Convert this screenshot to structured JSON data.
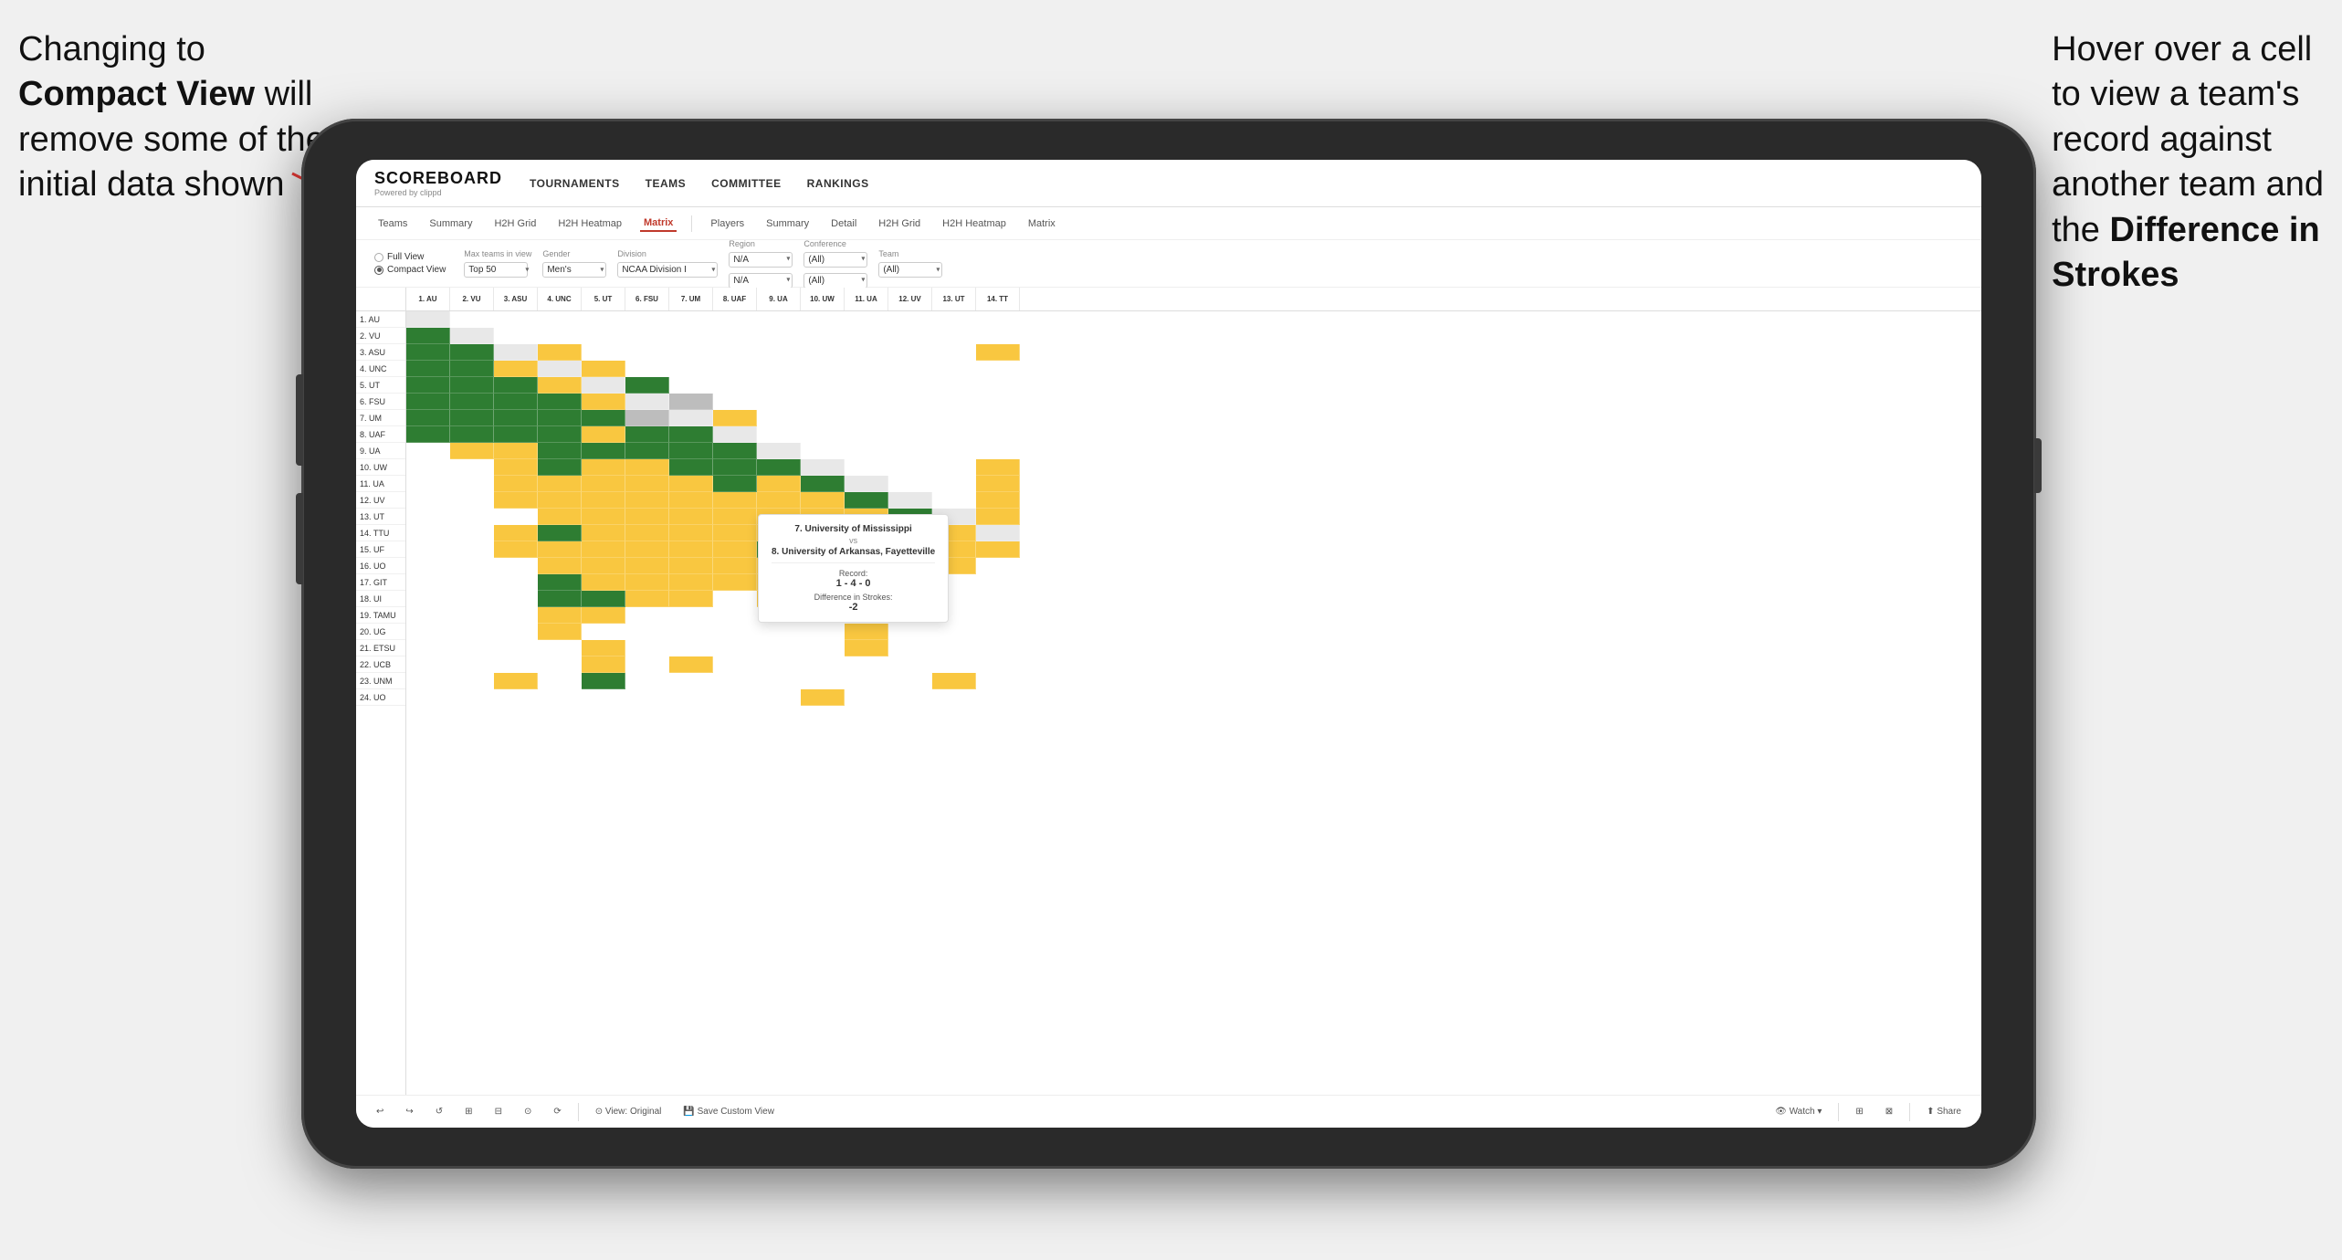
{
  "annotations": {
    "left": {
      "line1": "Changing to",
      "line2_bold": "Compact View",
      "line2_rest": " will",
      "line3": "remove some of the",
      "line4": "initial data shown"
    },
    "right": {
      "line1": "Hover over a cell",
      "line2": "to view a team's",
      "line3": "record against",
      "line4": "another team and",
      "line5_pre": "the ",
      "line5_bold": "Difference in",
      "line6_bold": "Strokes"
    }
  },
  "app": {
    "logo_title": "SCOREBOARD",
    "logo_subtitle": "Powered by clippd",
    "nav": [
      "TOURNAMENTS",
      "TEAMS",
      "COMMITTEE",
      "RANKINGS"
    ]
  },
  "sub_nav": {
    "group1": [
      "Teams",
      "Summary",
      "H2H Grid",
      "H2H Heatmap",
      "Matrix"
    ],
    "group2": [
      "Players",
      "Summary",
      "Detail",
      "H2H Grid",
      "H2H Heatmap",
      "Matrix"
    ],
    "active": "Matrix"
  },
  "filters": {
    "view_options": [
      "Full View",
      "Compact View"
    ],
    "selected_view": "Compact View",
    "max_teams_label": "Max teams in view",
    "max_teams_value": "Top 50",
    "gender_label": "Gender",
    "gender_value": "Men's",
    "division_label": "Division",
    "division_value": "NCAA Division I",
    "region_label": "Region",
    "region_value": "N/A",
    "conference_label": "Conference",
    "conference_value": "(All)",
    "team_label": "Team",
    "team_value": "(All)"
  },
  "col_headers": [
    "1. AU",
    "2. VU",
    "3. ASU",
    "4. UNC",
    "5. UT",
    "6. FSU",
    "7. UM",
    "8. UAF",
    "9. UA",
    "10. UW",
    "11. UA",
    "12. UV",
    "13. UT",
    "14. TT"
  ],
  "row_teams": [
    "1. AU",
    "2. VU",
    "3. ASU",
    "4. UNC",
    "5. UT",
    "6. FSU",
    "7. UM",
    "8. UAF",
    "9. UA",
    "10. UW",
    "11. UA",
    "12. UV",
    "13. UT",
    "14. TTU",
    "15. UF",
    "16. UO",
    "17. GIT",
    "18. UI",
    "19. TAMU",
    "20. UG",
    "21. ETSU",
    "22. UCB",
    "23. UNM",
    "24. UO"
  ],
  "tooltip": {
    "team1": "7. University of Mississippi",
    "vs": "vs",
    "team2": "8. University of Arkansas, Fayetteville",
    "record_label": "Record:",
    "record_value": "1 - 4 - 0",
    "strokes_label": "Difference in Strokes:",
    "strokes_value": "-2"
  },
  "toolbar": {
    "undo": "↩",
    "redo": "↪",
    "view_original": "⊙ View: Original",
    "save_custom": "💾 Save Custom View",
    "watch": "👁 Watch ▾",
    "share": "⬆ Share"
  }
}
